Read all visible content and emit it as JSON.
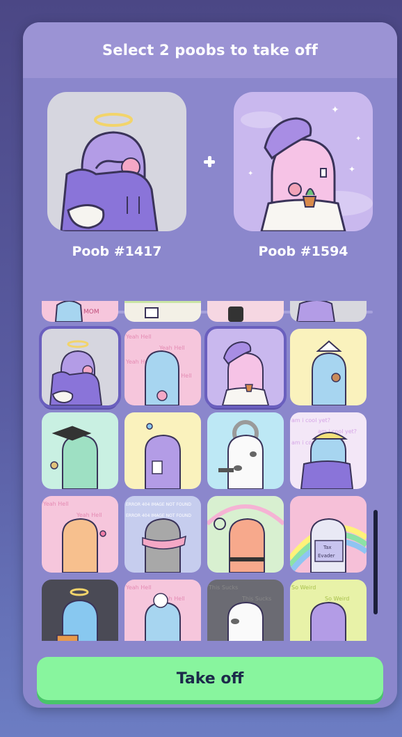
{
  "modal": {
    "title": "Select 2 poobs to take off"
  },
  "selected": [
    {
      "label": "Poob #1417"
    },
    {
      "label": "Poob #1594"
    }
  ],
  "action": {
    "label": "Take off"
  },
  "colors": {
    "background": "#4b4785",
    "panel": "#8b87cc",
    "header": "#9b93d4",
    "button": "#88f59e",
    "selection_border": "#6a5fbe"
  },
  "grid_patterns": {
    "yeah_hell": "Yeah Hell",
    "im_cool": "am i cool yet?",
    "error_404": "ERROR 404 IMAGE NOT FOUND",
    "this_sucks": "This Sucks",
    "so_weird": "So Weird",
    "tax": "Tax",
    "evader": "Evader",
    "mom": "MOM"
  }
}
